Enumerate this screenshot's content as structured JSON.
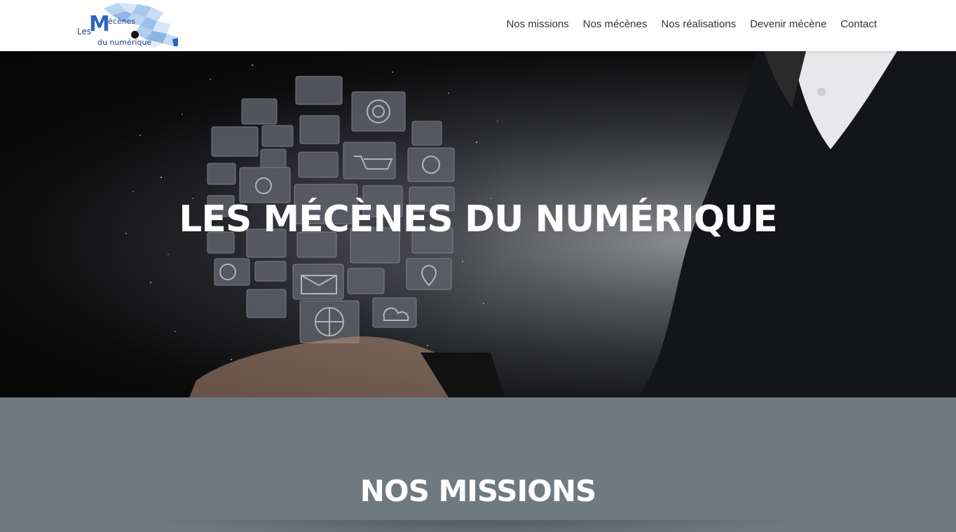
{
  "header": {
    "logo": {
      "les": "Les",
      "m": "M",
      "ecenes": "écènes",
      "du_numerique": "du numérique"
    },
    "nav": [
      {
        "label": "Nos missions"
      },
      {
        "label": "Nos mécènes"
      },
      {
        "label": "Nos réalisations"
      },
      {
        "label": "Devenir mécène"
      },
      {
        "label": "Contact"
      }
    ]
  },
  "hero": {
    "title": "LES MÉCÈNES DU NUMÉRIQUE",
    "icons": [
      "camera-icon",
      "video-camera-icon",
      "tv-icon",
      "wifi-icon",
      "twitter-icon",
      "shopping-cart-icon",
      "lightbulb-icon",
      "target-icon",
      "at-sign-icon",
      "chat-icon",
      "world-map-icon",
      "monitor-icon",
      "user-icon",
      "phone-icon",
      "music-icon",
      "download-icon",
      "mail-icon",
      "thumbs-up-icon",
      "location-pin-icon",
      "bar-chart-icon",
      "globe-icon",
      "cloud-icon"
    ]
  },
  "missions": {
    "title": "NOS MISSIONS"
  },
  "colors": {
    "header_bg": "#ffffff",
    "nav_text": "#333333",
    "section_bg": "#6f7980",
    "title_text": "#ffffff",
    "logo_blue": "#2f63c7"
  }
}
